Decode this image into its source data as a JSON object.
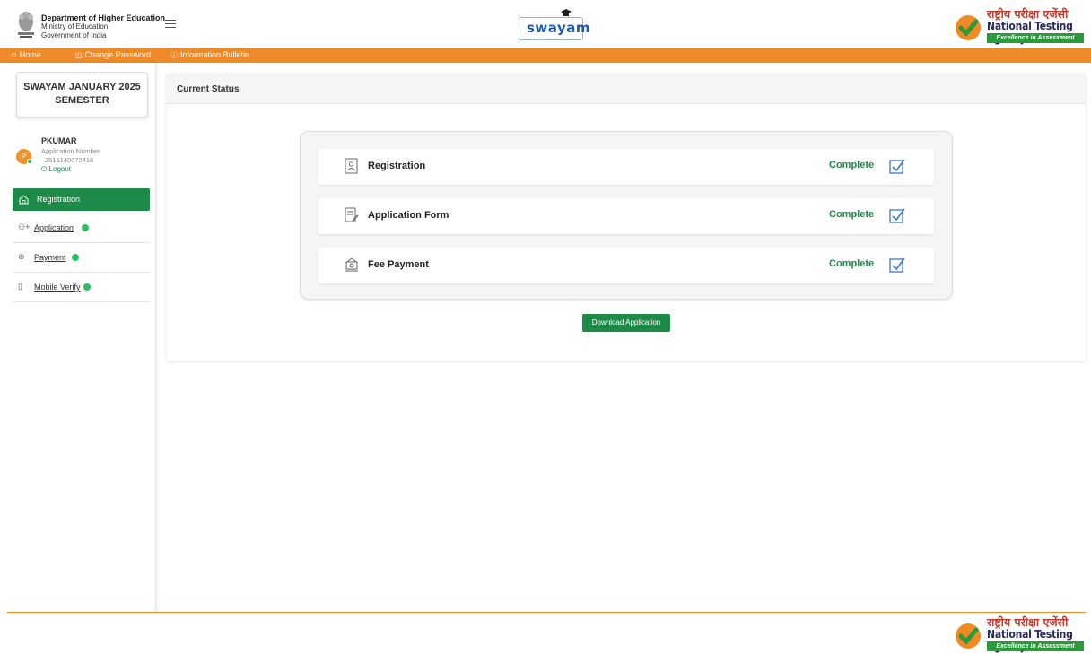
{
  "header": {
    "dept_line1": "Department of Higher Education",
    "dept_line2": "Ministry of Education",
    "dept_line3": "Government of India",
    "swayam_logo": "swayam",
    "nta_hindi": "राष्ट्रीय परीक्षा एजेंसी",
    "nta_english": "National Testing Agency",
    "nta_tagline": "Excellence in Assessment"
  },
  "nav": {
    "home": "Home",
    "change_password": "Change Password",
    "info_bulletin": "Information Bulletin"
  },
  "sidebar": {
    "semester_line1": "SWAYAM JANUARY 2025",
    "semester_line2": "SEMESTER",
    "avatar_letter": "P",
    "user_name": "PKUMAR",
    "app_label": "Application Number",
    "app_number": "2515140072416",
    "logout": "Logout",
    "active_item": "Registration",
    "items": [
      {
        "label": "Application",
        "icon": "user-plus-icon",
        "done": true
      },
      {
        "label": "Payment",
        "icon": "payment-icon",
        "done": true
      },
      {
        "label": "Mobile Verify",
        "icon": "mobile-icon",
        "done": true
      }
    ]
  },
  "main": {
    "title": "Current Status",
    "rows": [
      {
        "label": "Registration",
        "status": "Complete",
        "icon": "registration-doc-icon"
      },
      {
        "label": "Application Form",
        "status": "Complete",
        "icon": "form-edit-icon"
      },
      {
        "label": "Fee Payment",
        "status": "Complete",
        "icon": "fee-payment-icon"
      }
    ],
    "download_button": "Download Application"
  },
  "colors": {
    "accent_orange": "#ee8a2a",
    "accent_green": "#1e8a4a"
  }
}
